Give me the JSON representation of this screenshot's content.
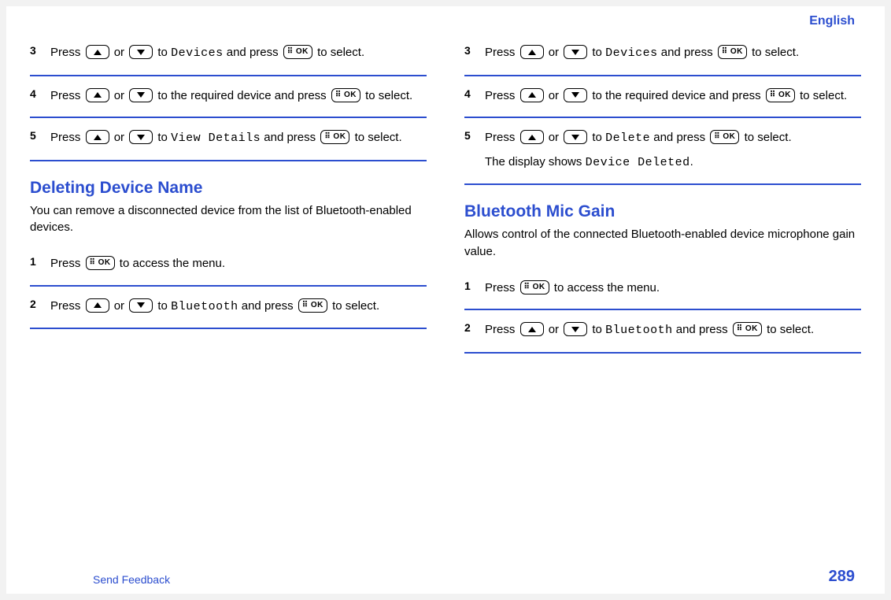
{
  "header": {
    "language": "English"
  },
  "left": {
    "steps_a": [
      {
        "num": "3",
        "prefix": "Press ",
        "mid_or": " or ",
        "mid_to": " to ",
        "menu": "Devices",
        "after_menu": " and press ",
        "tail": " to select."
      },
      {
        "num": "4",
        "prefix": "Press ",
        "mid_or": " or ",
        "mid_to": " to the required device and press ",
        "tail": " to select."
      },
      {
        "num": "5",
        "prefix": "Press ",
        "mid_or": " or ",
        "mid_to": " to ",
        "menu": "View Details",
        "after_menu": " and press ",
        "tail": " to select."
      }
    ],
    "section_title": "Deleting Device Name",
    "section_intro": "You can remove a disconnected device from the list of Bluetooth-enabled devices.",
    "steps_b": [
      {
        "num": "1",
        "prefix": "Press ",
        "tail": " to access the menu."
      },
      {
        "num": "2",
        "prefix": "Press ",
        "mid_or": " or ",
        "mid_to": " to ",
        "menu": "Bluetooth",
        "after_menu": " and press ",
        "tail": " to select."
      }
    ]
  },
  "right": {
    "steps_a": [
      {
        "num": "3",
        "prefix": "Press ",
        "mid_or": " or ",
        "mid_to": " to ",
        "menu": "Devices",
        "after_menu": " and press ",
        "tail": " to select."
      },
      {
        "num": "4",
        "prefix": "Press ",
        "mid_or": " or ",
        "mid_to": " to the required device and press ",
        "tail": " to select."
      },
      {
        "num": "5",
        "prefix": "Press ",
        "mid_or": " or ",
        "mid_to": " to ",
        "menu": "Delete",
        "after_menu": " and press ",
        "tail": " to select.",
        "result_prefix": "The display shows ",
        "result_menu": "Device Deleted",
        "result_suffix": "."
      }
    ],
    "section_title": "Bluetooth Mic Gain",
    "section_intro": "Allows control of the connected Bluetooth-enabled device microphone gain value.",
    "steps_b": [
      {
        "num": "1",
        "prefix": "Press ",
        "tail": " to access the menu."
      },
      {
        "num": "2",
        "prefix": "Press ",
        "mid_or": " or ",
        "mid_to": " to ",
        "menu": "Bluetooth",
        "after_menu": " and press ",
        "tail": " to select."
      }
    ]
  },
  "buttons": {
    "ok_label": "⠿ OK"
  },
  "footer": {
    "feedback": "Send Feedback",
    "page": "289"
  }
}
